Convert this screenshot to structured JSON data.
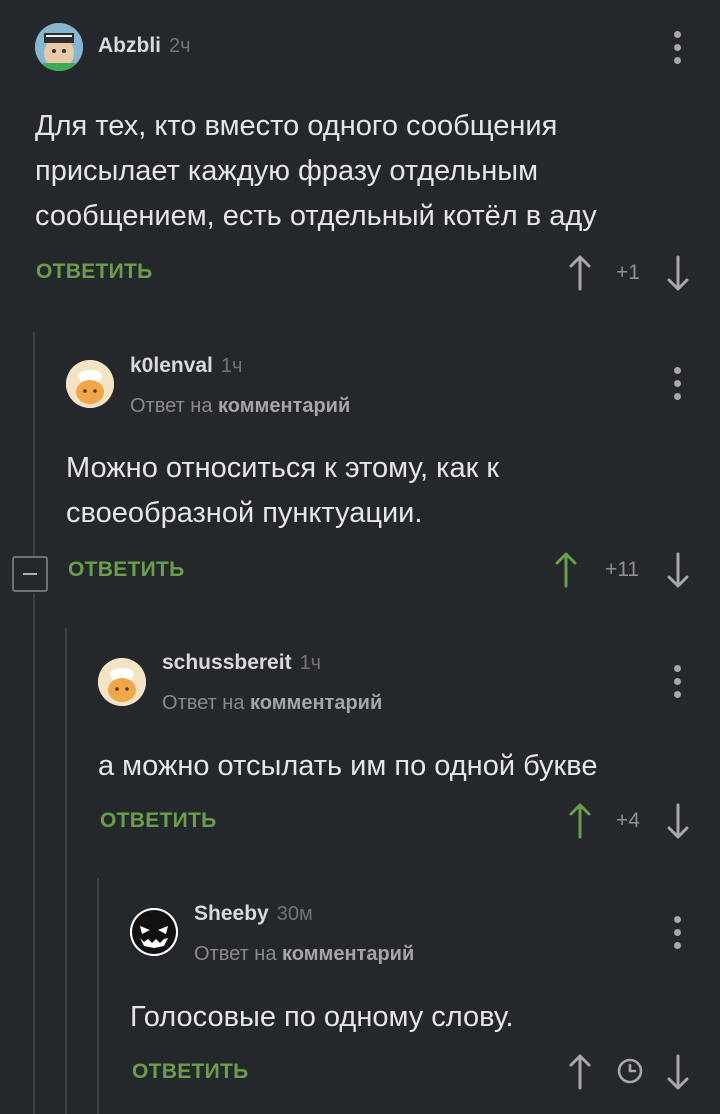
{
  "comments": [
    {
      "author": "Abzbli",
      "time": "2ч",
      "body_lines": [
        "Для тех, кто вместо одного сообщения",
        "присылает каждую фразу отдельным",
        "сообщением, есть отдельный котёл в аду"
      ],
      "reply_label": "ОТВЕТИТЬ",
      "rating": "+1"
    },
    {
      "author": "k0lenval",
      "time": "1ч",
      "reply_prefix": "Ответ на",
      "reply_target": "комментарий",
      "body_lines": [
        "Можно относиться к этому, как к",
        "своеобразной пунктуации."
      ],
      "reply_label": "ОТВЕТИТЬ",
      "rating": "+11"
    },
    {
      "author": "schussbereit",
      "time": "1ч",
      "reply_prefix": "Ответ на",
      "reply_target": "комментарий",
      "body_lines": [
        "а можно отсылать им по одной букве"
      ],
      "reply_label": "ОТВЕТИТЬ",
      "rating": "+4"
    },
    {
      "author": "Sheeby",
      "time": "30м",
      "reply_prefix": "Ответ на",
      "reply_target": "комментарий",
      "body_lines": [
        "Голосовые по одному слову."
      ],
      "reply_label": "ОТВЕТИТЬ",
      "rating_icon": "clock-icon"
    }
  ],
  "colors": {
    "background": "#24272b",
    "accent_green": "#6b9e4a",
    "thread_line": "#3d4147"
  }
}
